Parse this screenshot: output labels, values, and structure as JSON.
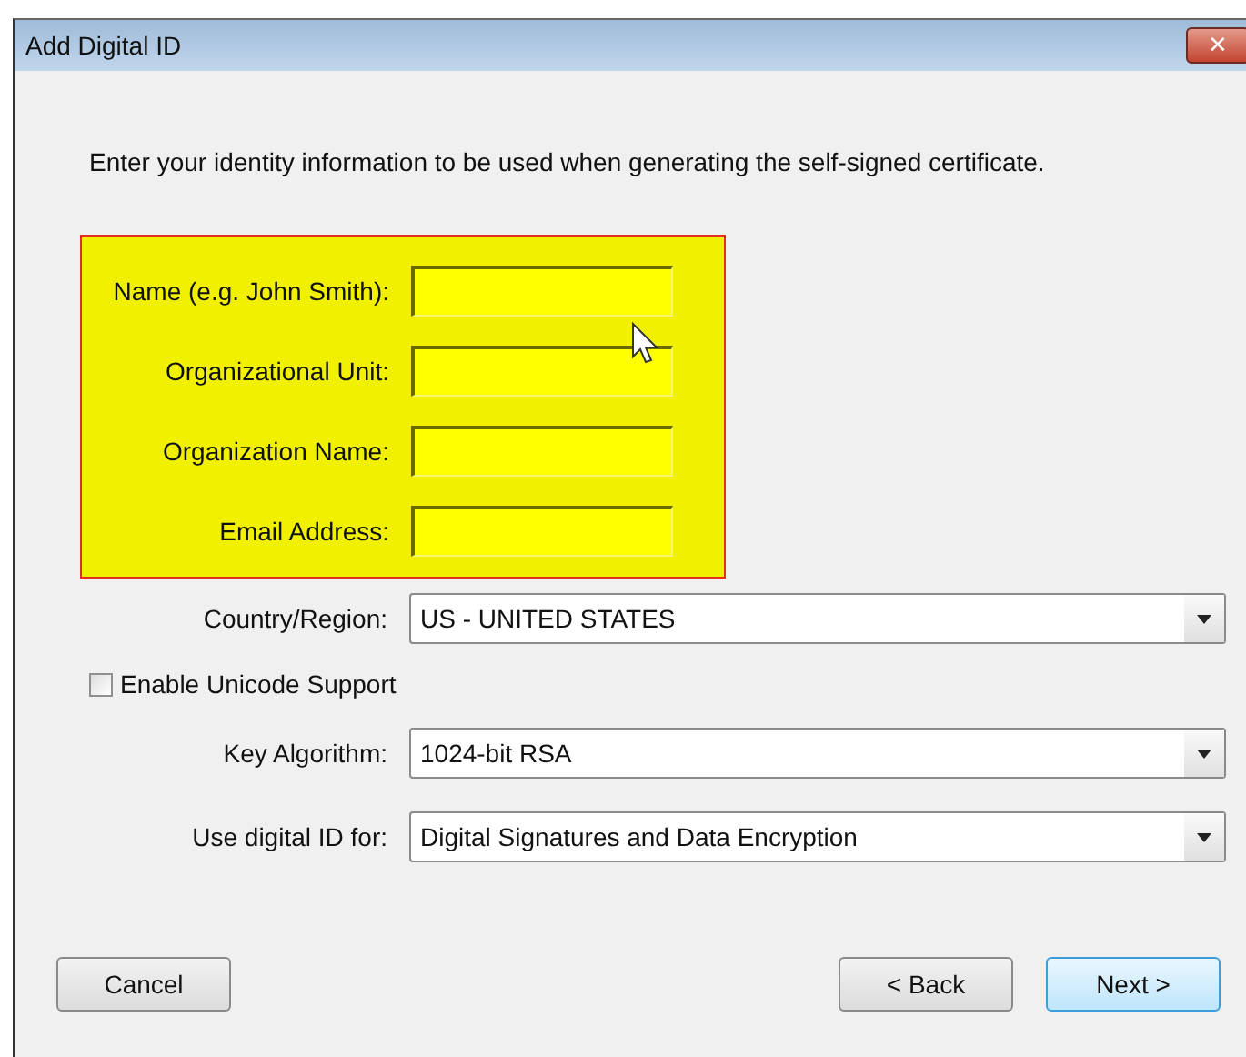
{
  "window": {
    "title": "Add Digital ID",
    "close": "✕"
  },
  "intro": "Enter your identity information to be used when generating the self-signed certificate.",
  "identity_fields": [
    {
      "label": "Name (e.g. John Smith):"
    },
    {
      "label": "Organizational Unit:"
    },
    {
      "label": "Organization Name:"
    },
    {
      "label": "Email Address:"
    }
  ],
  "country": {
    "label": "Country/Region:",
    "value": "US - UNITED STATES"
  },
  "unicode": {
    "label": "Enable Unicode Support",
    "checked": false
  },
  "key_algorithm": {
    "label": "Key Algorithm:",
    "value": "1024-bit RSA"
  },
  "usage": {
    "label": "Use digital ID for:",
    "value": "Digital Signatures and Data Encryption"
  },
  "buttons": [
    {
      "label": "Cancel",
      "kind": "cancel",
      "default": false
    },
    {
      "label": "< Back",
      "kind": "back",
      "default": false
    },
    {
      "label": "Next >",
      "kind": "next",
      "default": true
    }
  ]
}
